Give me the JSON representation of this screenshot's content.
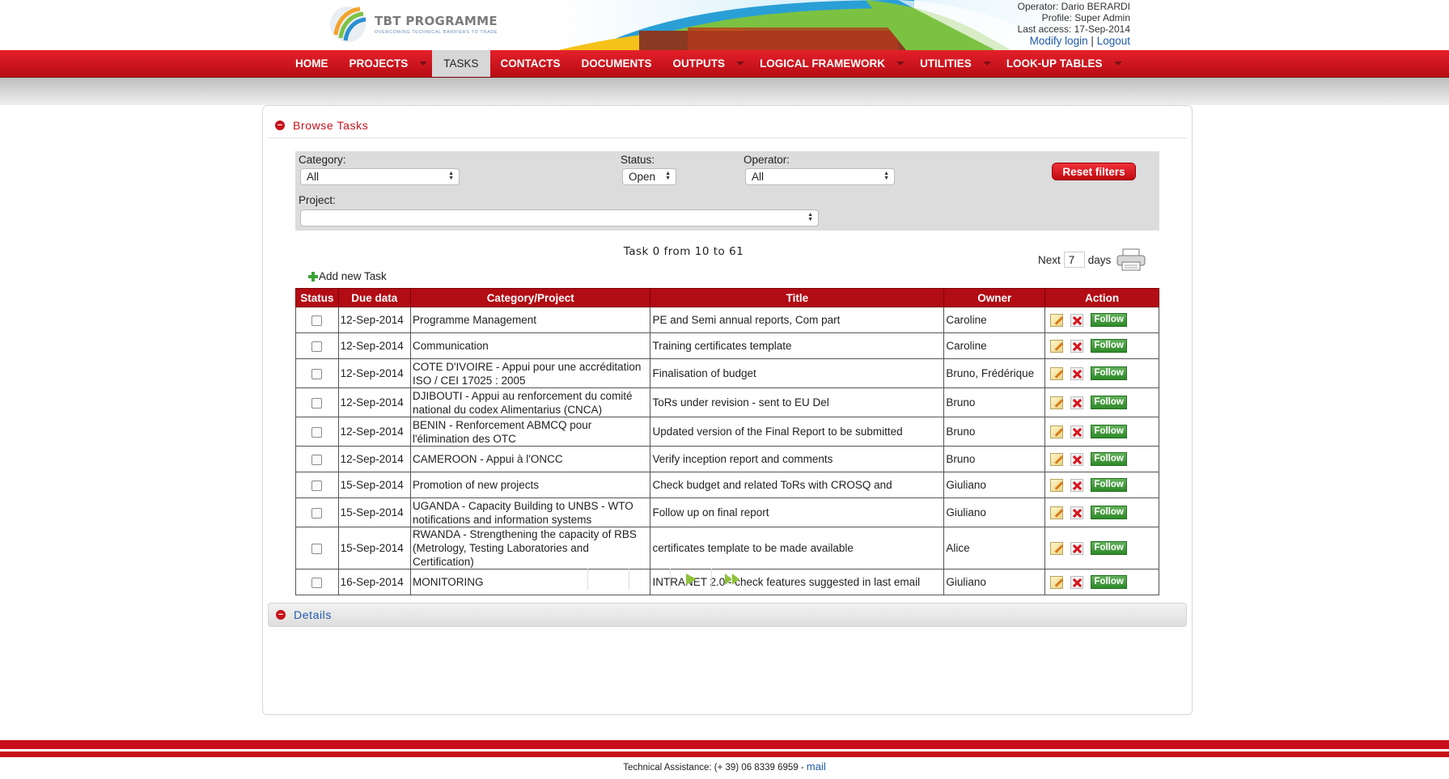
{
  "header": {
    "logo_title": "TBT PROGRAMME",
    "logo_subtitle": "OVERCOMING TECHNICAL BARRIERS TO TRADE",
    "operator": "Operator: Dario BERARDI",
    "profile": "Profile: Super Admin",
    "last_access": "Last access: 17-Sep-2014",
    "modify_login": "Modify login",
    "separator": "|",
    "logout": "Logout"
  },
  "nav": {
    "home": "HOME",
    "projects": "PROJECTS",
    "tasks": "TASKS",
    "contacts": "CONTACTS",
    "documents": "DOCUMENTS",
    "outputs": "OUTPUTS",
    "logical_framework": "LOGICAL FRAMEWORK",
    "utilities": "UTILITIES",
    "lookup_tables": "LOOK-UP TABLES",
    "active": "TASKS"
  },
  "browse": {
    "section_title": "Browse Tasks",
    "category_label": "Category:",
    "category_value": "All",
    "status_label": "Status:",
    "status_value": "Open",
    "operator_label": "Operator:",
    "operator_value": "All",
    "project_label": "Project:",
    "project_value": "",
    "reset_label": "Reset filters",
    "task_count": "Task 0 from 10 to 61",
    "next_label": "Next",
    "next_days_value": "7",
    "days_label": "days",
    "add_task_label": "Add new Task"
  },
  "table": {
    "headers": [
      "Status",
      "Due data",
      "Category/Project",
      "Title",
      "Owner",
      "Action"
    ],
    "follow_label": "Follow",
    "rows": [
      {
        "due": "12-Sep-2014",
        "category": "Programme Management",
        "title": "PE and Semi annual reports, Com part",
        "owner": "Caroline"
      },
      {
        "due": "12-Sep-2014",
        "category": "Communication",
        "title": "Training certificates template",
        "owner": "Caroline"
      },
      {
        "due": "12-Sep-2014",
        "category": "COTE D'IVOIRE - Appui pour une accréditation ISO / CEI 17025 : 2005",
        "title": "Finalisation of budget",
        "owner": "Bruno, Frédérique"
      },
      {
        "due": "12-Sep-2014",
        "category": "DJIBOUTI - Appui au renforcement du comité national du codex Alimentarius (CNCA)",
        "title": "ToRs under revision - sent to EU Del",
        "owner": "Bruno"
      },
      {
        "due": "12-Sep-2014",
        "category": "BENIN - Renforcement ABMCQ pour l'élimination des OTC",
        "title": "Updated version of the Final Report to be submitted",
        "owner": "Bruno"
      },
      {
        "due": "12-Sep-2014",
        "category": "CAMEROON - Appui à l'ONCC",
        "title": "Verify inception report and comments",
        "owner": "Bruno"
      },
      {
        "due": "15-Sep-2014",
        "category": "Promotion of new projects",
        "title": "Check budget and related ToRs with CROSQ and",
        "owner": "Giuliano"
      },
      {
        "due": "15-Sep-2014",
        "category": "UGANDA - Capacity Building to UNBS - WTO notifications and information systems",
        "title": "Follow up on final report",
        "owner": "Giuliano"
      },
      {
        "due": "15-Sep-2014",
        "category": "RWANDA - Strengthening the capacity of RBS (Metrology, Testing Laboratories and Certification)",
        "title": "certificates template to be made available",
        "owner": "Alice"
      },
      {
        "due": "16-Sep-2014",
        "category": "MONITORING",
        "title": "INTRANET 2.0 - check features suggested in last email",
        "owner": "Giuliano"
      }
    ]
  },
  "details": {
    "section_title": "Details"
  },
  "footer": {
    "assistance": "Technical Assistance: (+ 39) 06 8339 6959 - ",
    "mail": "mail"
  },
  "colors": {
    "brand_red": "#c8101a",
    "link_blue": "#1f5ba8",
    "follow_green": "#3d9a36"
  }
}
